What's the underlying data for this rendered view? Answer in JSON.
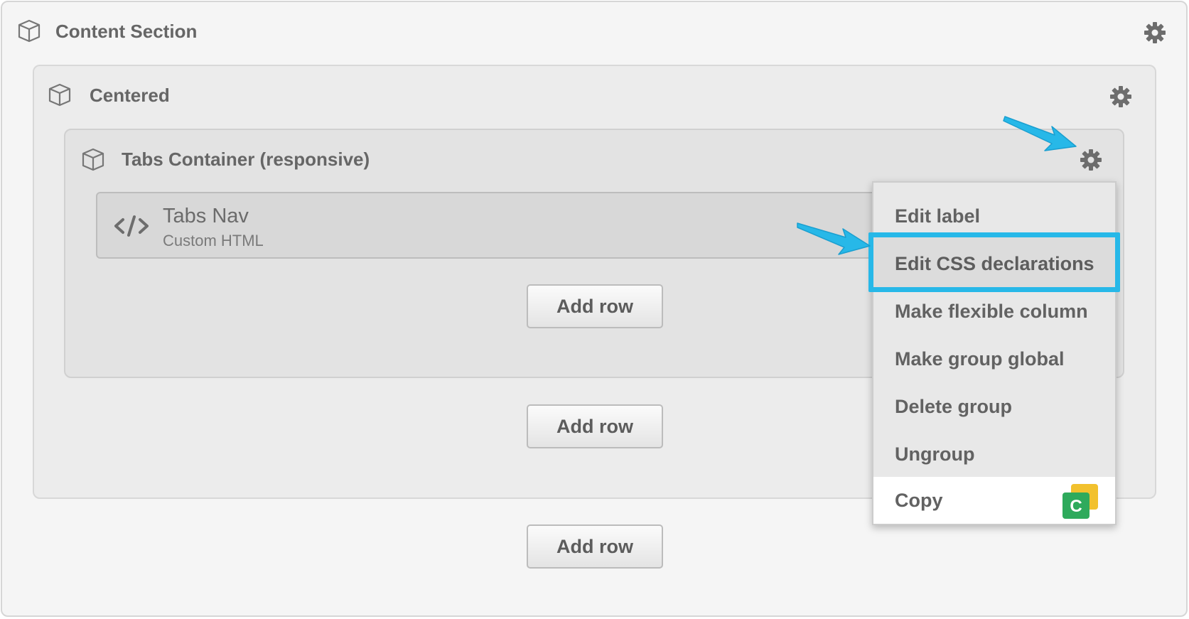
{
  "section": {
    "title": "Content Section",
    "icon": "cube-icon",
    "settings_icon": "gear-icon"
  },
  "centered": {
    "title": "Centered",
    "icon": "cube-icon",
    "settings_icon": "gear-icon"
  },
  "tabs_container": {
    "title": "Tabs Container (responsive)",
    "icon": "cube-icon",
    "settings_icon": "gear-icon"
  },
  "tabs_nav": {
    "title": "Tabs Nav",
    "subtitle": "Custom HTML",
    "icon": "code-icon"
  },
  "add_row_label": "Add row",
  "context_menu": {
    "items": [
      {
        "label": "Edit label"
      },
      {
        "label": "Edit CSS declarations",
        "highlighted": true
      },
      {
        "label": "Make flexible column"
      },
      {
        "label": "Make group global"
      },
      {
        "label": "Delete group"
      },
      {
        "label": "Ungroup"
      },
      {
        "label": "Copy",
        "badge": "C",
        "hovered": true
      }
    ]
  },
  "colors": {
    "highlight": "#27b8e8",
    "arrow": "#27b8e8",
    "badge_green": "#2eaa5c",
    "badge_yellow": "#f2c12e"
  }
}
